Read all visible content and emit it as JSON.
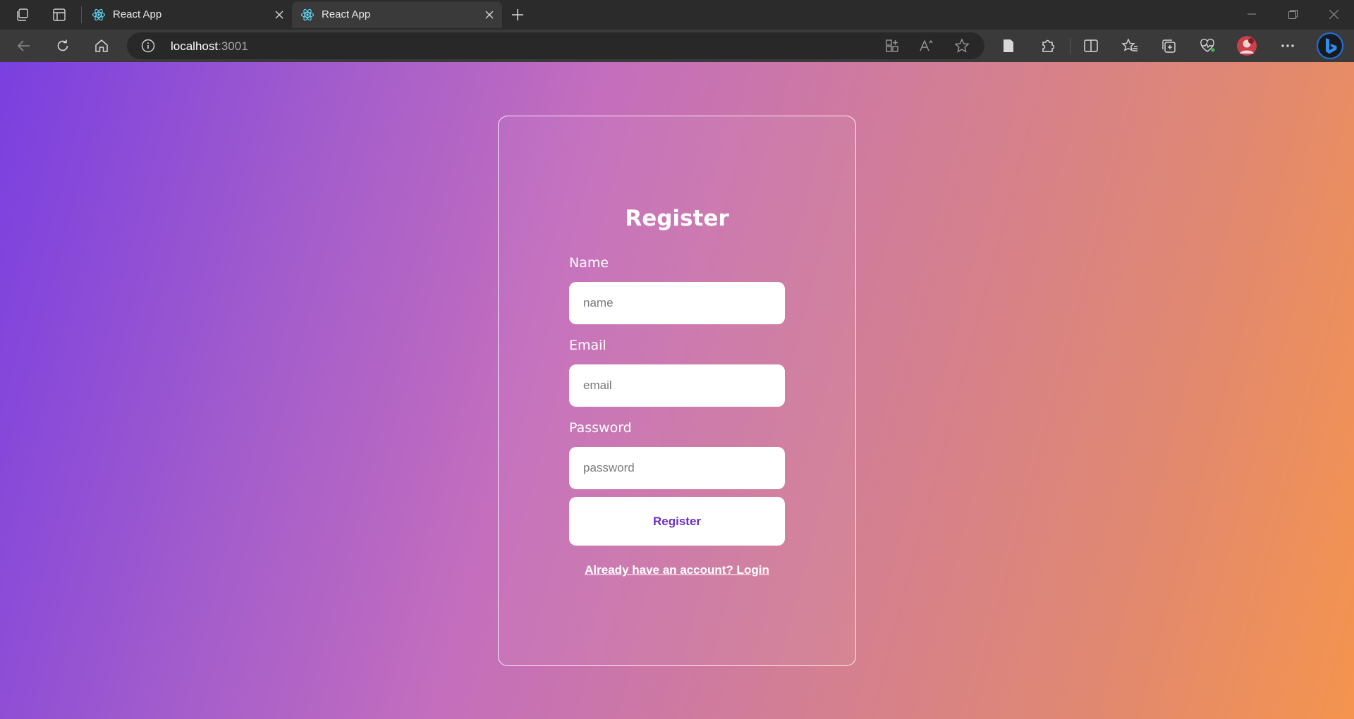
{
  "browser": {
    "tabs": [
      {
        "title": "React App",
        "active": false
      },
      {
        "title": "React App",
        "active": true
      }
    ],
    "address": {
      "host": "localhost",
      "port": ":3001"
    },
    "icons": {
      "workspaces": "workspaces-icon",
      "tab_actions": "tab-actions-icon",
      "favicon": "react-logo-icon",
      "back": "back-arrow-icon",
      "refresh": "refresh-icon",
      "home": "home-icon",
      "site_info": "info-icon",
      "app_available": "app-available-icon",
      "read_aloud": "read-aloud-icon",
      "favorite": "star-icon",
      "extensions": "puzzle-icon",
      "split_screen": "split-screen-icon",
      "favorites": "favorites-icon",
      "collections": "collections-icon",
      "performance": "heartbeat-icon",
      "menu": "more-icon",
      "copilot": "bing-icon"
    },
    "accent": "#1e6fd9"
  },
  "form": {
    "title": "Register",
    "fields": [
      {
        "label": "Name",
        "placeholder": "name",
        "value": ""
      },
      {
        "label": "Email",
        "placeholder": "email",
        "value": ""
      },
      {
        "label": "Password",
        "placeholder": "password",
        "value": ""
      }
    ],
    "submit_label": "Register",
    "login_link": "Already have an account? Login"
  },
  "colors": {
    "gradient_start": "#7a3fe0",
    "gradient_mid": "#c46ebd",
    "gradient_end": "#f5944e",
    "button_text": "#6a2fc4"
  }
}
